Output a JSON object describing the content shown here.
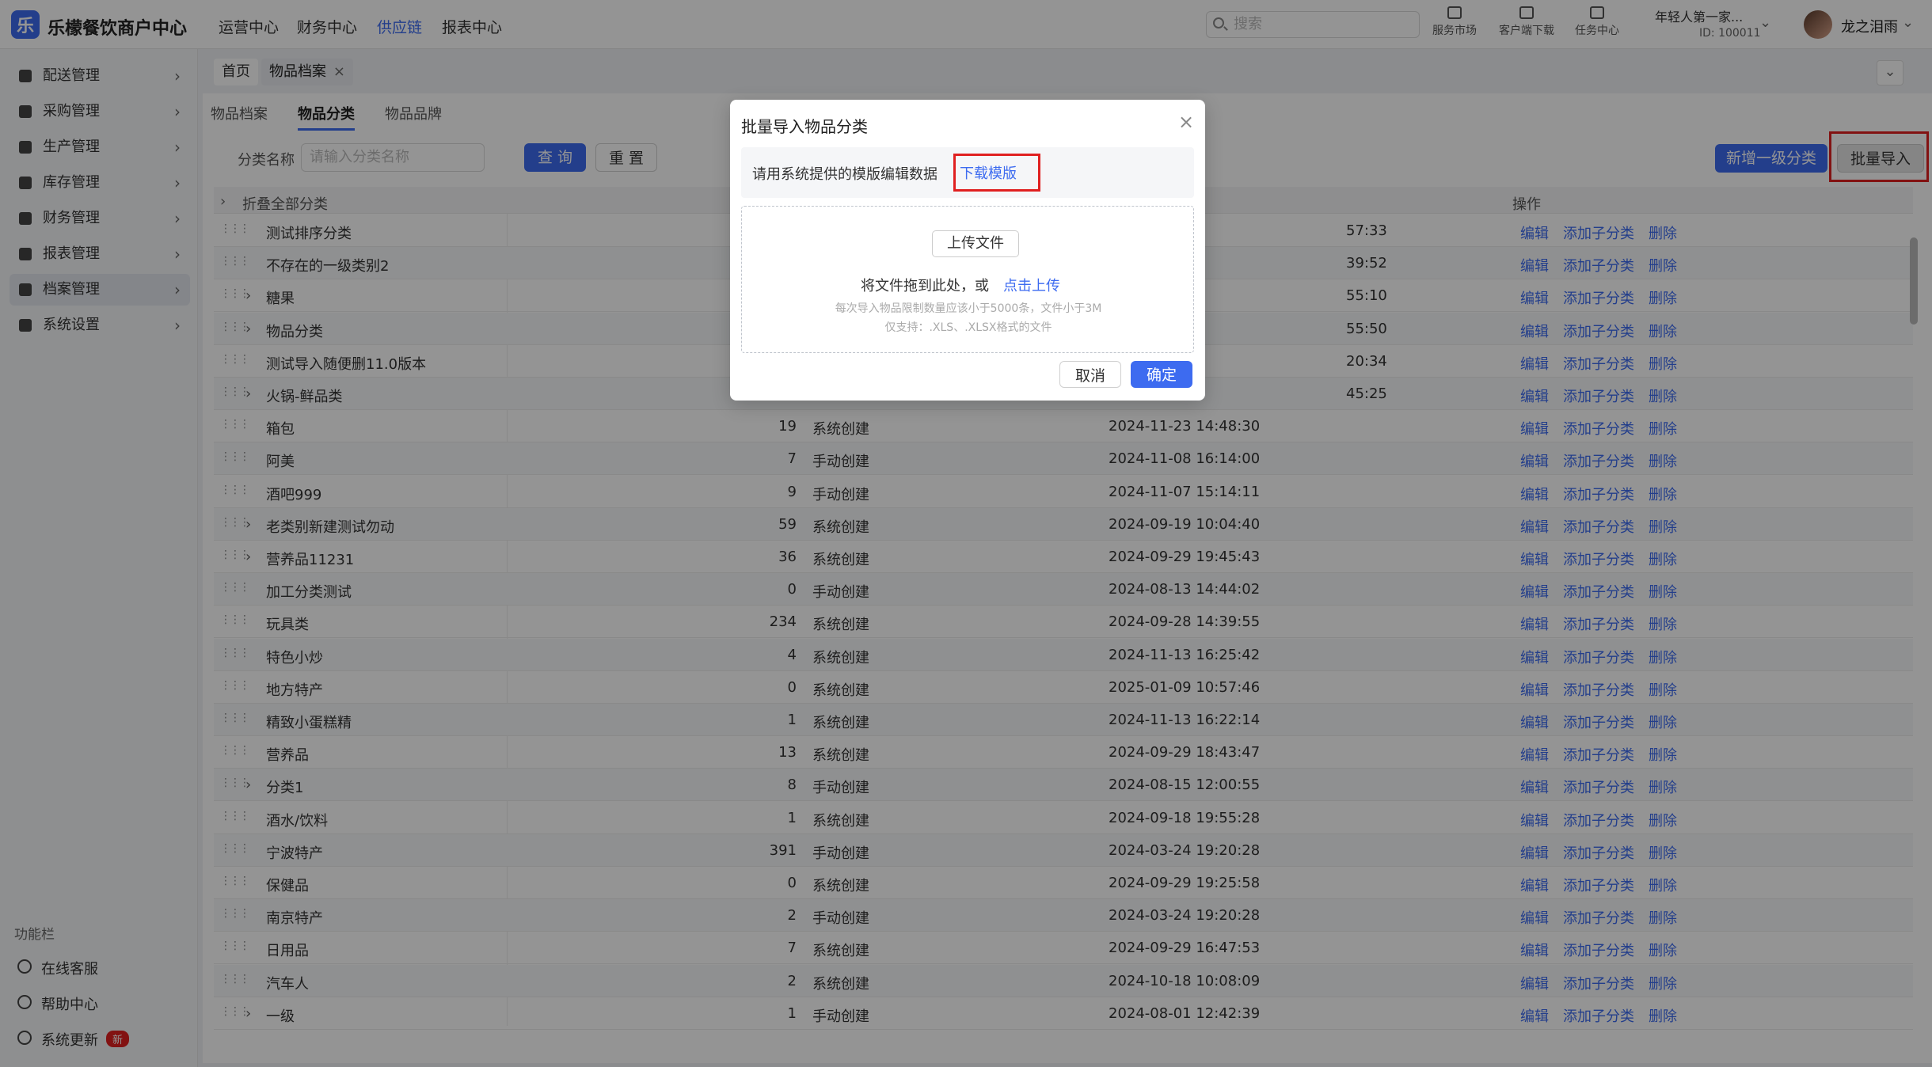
{
  "header": {
    "logo_glyph": "乐",
    "brand": "乐檬餐饮商户中心",
    "nav": [
      "运营中心",
      "财务中心",
      "供应链",
      "报表中心"
    ],
    "nav_active": "供应链",
    "search_placeholder": "搜索",
    "tools": [
      "服务市场",
      "客户端下载",
      "任务中心"
    ],
    "tenant_name": "年轻人第一家...",
    "tenant_id": "ID: 100011",
    "username": "龙之泪雨"
  },
  "sidebar": {
    "items": [
      "配送管理",
      "采购管理",
      "生产管理",
      "库存管理",
      "财务管理",
      "报表管理",
      "档案管理",
      "系统设置"
    ],
    "active": "档案管理",
    "func_label": "功能栏",
    "func_items": [
      "在线客服",
      "帮助中心",
      "系统更新"
    ],
    "new_badge": "新"
  },
  "tabs": {
    "home": "首页",
    "current": "物品档案",
    "close": "×",
    "collapse": "⌄"
  },
  "sub_tabs": [
    "物品档案",
    "物品分类",
    "物品品牌"
  ],
  "sub_tab_active": "物品分类",
  "filter": {
    "label": "分类名称",
    "placeholder": "请输入分类名称",
    "query": "查 询",
    "reset": "重 置",
    "add_top": "新增一级分类",
    "batch_import": "批量导入"
  },
  "table": {
    "header_first": "折叠全部分类",
    "header_action": "操作",
    "actions": [
      "编辑",
      "添加子分类",
      "删除"
    ],
    "rows": [
      {
        "name": "测试排序分类",
        "expand": false,
        "count": "",
        "src": "",
        "time": "57:33"
      },
      {
        "name": "不存在的一级类别2",
        "expand": false,
        "count": "",
        "src": "",
        "time": "39:52"
      },
      {
        "name": "糖果",
        "expand": true,
        "count": "",
        "src": "",
        "time": "55:10"
      },
      {
        "name": "物品分类",
        "expand": true,
        "count": "",
        "src": "",
        "time": "55:50"
      },
      {
        "name": "测试导入随便删11.0版本",
        "expand": false,
        "count": "",
        "src": "",
        "time": "20:34"
      },
      {
        "name": "火锅-鲜品类",
        "expand": true,
        "count": "",
        "src": "",
        "time": "45:25"
      },
      {
        "name": "箱包",
        "expand": false,
        "count": "19",
        "src": "系统创建",
        "time": "2024-11-23 14:48:30"
      },
      {
        "name": "阿美",
        "expand": false,
        "count": "7",
        "src": "手动创建",
        "time": "2024-11-08 16:14:00"
      },
      {
        "name": "酒吧999",
        "expand": false,
        "count": "9",
        "src": "手动创建",
        "time": "2024-11-07 15:14:11"
      },
      {
        "name": "老类别新建测试勿动",
        "expand": true,
        "count": "59",
        "src": "系统创建",
        "time": "2024-09-19 10:04:40"
      },
      {
        "name": "营养品11231",
        "expand": true,
        "count": "36",
        "src": "系统创建",
        "time": "2024-09-29 19:45:43"
      },
      {
        "name": "加工分类测试",
        "expand": false,
        "count": "0",
        "src": "手动创建",
        "time": "2024-08-13 14:44:02"
      },
      {
        "name": "玩具类",
        "expand": false,
        "count": "234",
        "src": "系统创建",
        "time": "2024-09-28 14:39:55"
      },
      {
        "name": "特色小炒",
        "expand": false,
        "count": "4",
        "src": "系统创建",
        "time": "2024-11-13 16:25:42"
      },
      {
        "name": "地方特产",
        "expand": false,
        "count": "0",
        "src": "系统创建",
        "time": "2025-01-09 10:57:46"
      },
      {
        "name": "精致小蛋糕精",
        "expand": false,
        "count": "1",
        "src": "系统创建",
        "time": "2024-11-13 16:22:14"
      },
      {
        "name": "营养品",
        "expand": false,
        "count": "13",
        "src": "系统创建",
        "time": "2024-09-29 18:43:47"
      },
      {
        "name": "分类1",
        "expand": true,
        "count": "8",
        "src": "手动创建",
        "time": "2024-08-15 12:00:55"
      },
      {
        "name": "酒水/饮料",
        "expand": false,
        "count": "1",
        "src": "系统创建",
        "time": "2024-09-18 19:55:28"
      },
      {
        "name": "宁波特产",
        "expand": false,
        "count": "391",
        "src": "手动创建",
        "time": "2024-03-24 19:20:28"
      },
      {
        "name": "保健品",
        "expand": false,
        "count": "0",
        "src": "系统创建",
        "time": "2024-09-29 19:25:58"
      },
      {
        "name": "南京特产",
        "expand": false,
        "count": "2",
        "src": "手动创建",
        "time": "2024-03-24 19:20:28"
      },
      {
        "name": "日用品",
        "expand": false,
        "count": "7",
        "src": "系统创建",
        "time": "2024-09-29 16:47:53"
      },
      {
        "name": "汽车人",
        "expand": false,
        "count": "2",
        "src": "系统创建",
        "time": "2024-10-18 10:08:09"
      },
      {
        "name": "一级",
        "expand": true,
        "count": "1",
        "src": "手动创建",
        "time": "2024-08-01 12:42:39"
      }
    ]
  },
  "modal": {
    "title": "批量导入物品分类",
    "close": "×",
    "tip": "请用系统提供的模版编辑数据",
    "download": "下载模版",
    "upload_btn": "上传文件",
    "drop_text": "将文件拖到此处，或",
    "click_upload": "点击上传",
    "limit": "每次导入物品限制数量应该小于5000条，文件小于3M",
    "formats": "仅支持：.XLS、.XLSX格式的文件",
    "cancel": "取消",
    "ok": "确定"
  },
  "colors": {
    "primary": "#3d6bf0",
    "highlight": "#e02020"
  }
}
